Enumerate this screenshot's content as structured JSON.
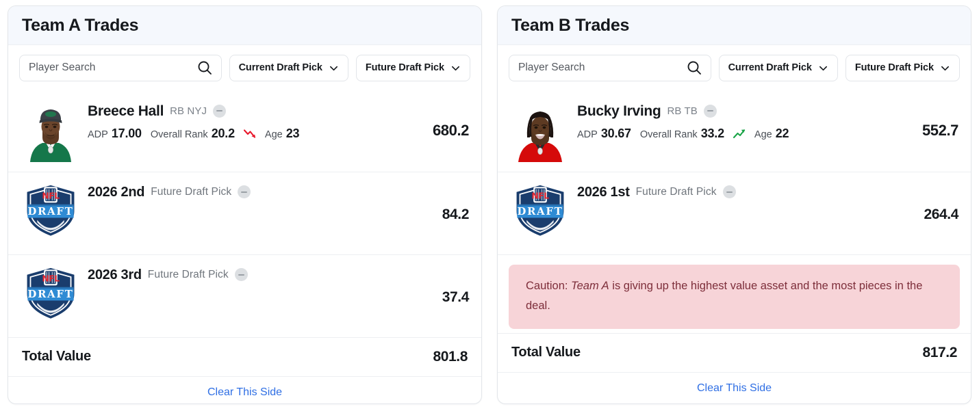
{
  "colors": {
    "header_bg": "#f5f8fd",
    "panel_border": "#e3e6ea",
    "link_blue": "#2f6fe4",
    "caution_bg": "#f7d4d8",
    "caution_text": "#7d2e3a",
    "trend_down": "#e8192c",
    "trend_up": "#1aa447",
    "remove_circle": "#dcdfe2"
  },
  "panels": [
    {
      "id": "team-a",
      "title": "Team A Trades",
      "search": {
        "value": "",
        "placeholder": "Player Search",
        "icon": "search-icon"
      },
      "filters": [
        {
          "label": "Current Draft Pick",
          "icon": "chevron-down-icon"
        },
        {
          "label": "Future Draft Pick",
          "icon": "chevron-down-icon"
        }
      ],
      "assets": [
        {
          "kind": "player",
          "avatar": "player-headshot-jets",
          "name": "Breece Hall",
          "sub": "RB NYJ",
          "remove_icon": "minus-circle-icon",
          "stats": [
            {
              "label": "ADP",
              "value": "17.00"
            },
            {
              "label": "Overall Rank",
              "value": "20.2"
            }
          ],
          "trend": "down",
          "trend_icon": "trend-down-icon",
          "age_label": "Age",
          "age_value": "23",
          "value": "680.2"
        },
        {
          "kind": "pick",
          "avatar": "nfl-draft-logo",
          "name": "2026 2nd",
          "sub": "Future Draft Pick",
          "remove_icon": "minus-circle-icon",
          "value": "84.2"
        },
        {
          "kind": "pick",
          "avatar": "nfl-draft-logo",
          "name": "2026 3rd",
          "sub": "Future Draft Pick",
          "remove_icon": "minus-circle-icon",
          "value": "37.4"
        }
      ],
      "caution": null,
      "total": {
        "label": "Total Value",
        "value": "801.8"
      },
      "clear": {
        "label": "Clear This Side"
      }
    },
    {
      "id": "team-b",
      "title": "Team B Trades",
      "search": {
        "value": "",
        "placeholder": "Player Search",
        "icon": "search-icon"
      },
      "filters": [
        {
          "label": "Current Draft Pick",
          "icon": "chevron-down-icon"
        },
        {
          "label": "Future Draft Pick",
          "icon": "chevron-down-icon"
        }
      ],
      "assets": [
        {
          "kind": "player",
          "avatar": "player-headshot-bucs",
          "name": "Bucky Irving",
          "sub": "RB TB",
          "remove_icon": "minus-circle-icon",
          "stats": [
            {
              "label": "ADP",
              "value": "30.67"
            },
            {
              "label": "Overall Rank",
              "value": "33.2"
            }
          ],
          "trend": "up",
          "trend_icon": "trend-up-icon",
          "age_label": "Age",
          "age_value": "22",
          "value": "552.7"
        },
        {
          "kind": "pick",
          "avatar": "nfl-draft-logo",
          "name": "2026 1st",
          "sub": "Future Draft Pick",
          "remove_icon": "minus-circle-icon",
          "value": "264.4"
        }
      ],
      "caution": {
        "prefix": "Caution: ",
        "emphasis": "Team A",
        "suffix": " is giving up the highest value asset and the most pieces in the deal."
      },
      "total": {
        "label": "Total Value",
        "value": "817.2"
      },
      "clear": {
        "label": "Clear This Side"
      }
    }
  ]
}
